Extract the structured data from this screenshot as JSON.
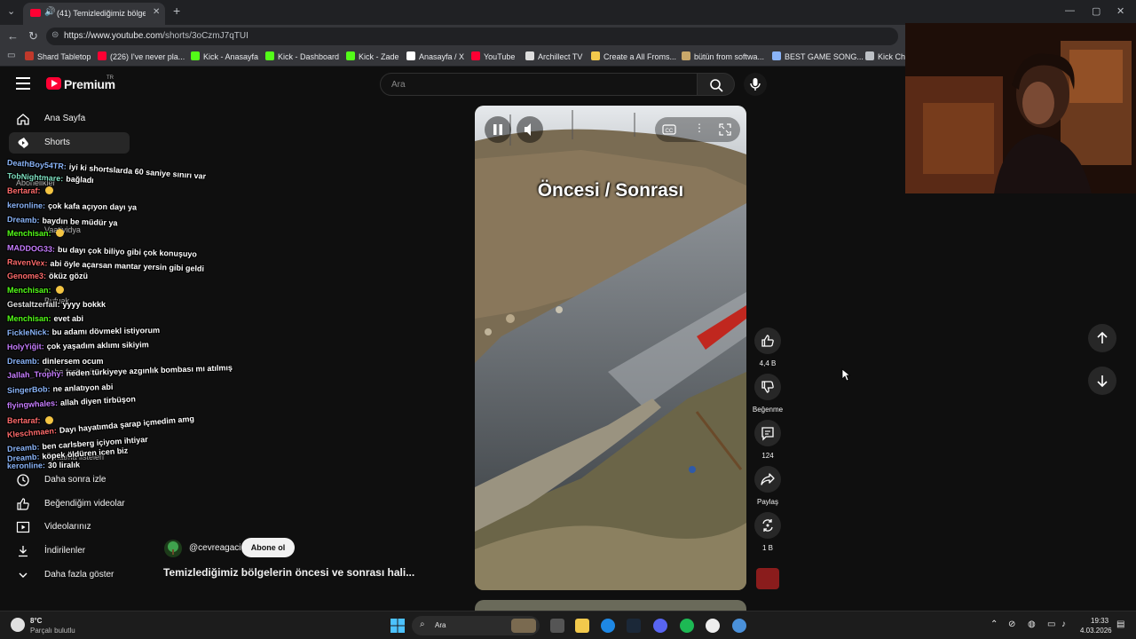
{
  "browser": {
    "tab_title": "(41) Temizlediğimiz bölgelerin",
    "url_host": "https://www.youtube.com",
    "url_path": "/shorts/3oCzmJ7qTUI",
    "bookmarks": [
      "Shard Tabletop",
      "(226) I've never pla...",
      "Kick - Anasayfa",
      "Kick - Dashboard",
      "Kick - Zade",
      "Anasayfa / X",
      "YouTube",
      "Archillect TV",
      "Create a All Froms...",
      "bütün from softwa...",
      "BEST GAME SONG...",
      "Kick Ch"
    ],
    "bookmark_colors": [
      "#c0392b",
      "#ff0033",
      "#53fc18",
      "#53fc18",
      "#53fc18",
      "#ffffff",
      "#ff0033",
      "#dddddd",
      "#f2c94c",
      "#c9a86a",
      "#8ab4f8",
      "#bdc1c6"
    ]
  },
  "youtube": {
    "logo_text": "Premium",
    "region": "TR",
    "search_placeholder": "Ara"
  },
  "sidebar": {
    "items": [
      {
        "label": "Ana Sayfa",
        "icon": "home-icon"
      },
      {
        "label": "Shorts",
        "icon": "shorts-icon"
      },
      {
        "label": "Daha sonra izle",
        "icon": "clock-icon"
      },
      {
        "label": "Beğendiğim videolar",
        "icon": "thumbs-up-icon"
      },
      {
        "label": "Videolarınız",
        "icon": "play-square-icon"
      },
      {
        "label": "İndirilenler",
        "icon": "download-icon"
      },
      {
        "label": "Daha fazla göster",
        "icon": "chevron-down-icon"
      }
    ],
    "faded_labels": [
      "Abonelikler",
      "Vaatividya",
      "Bufuak",
      "Daha fazla göster",
      "Oynatma listeleri"
    ]
  },
  "chat": [
    {
      "user": "DeathBoy54TR:",
      "msg": "iyi ki shortslarda 60 saniye sınırı var",
      "color": "#8ab4f8"
    },
    {
      "user": "TobNightmare:",
      "msg": "bağladı",
      "color": "#7ee0c0"
    },
    {
      "user": "Bertaraf:",
      "msg": "",
      "color": "#ff6b6b"
    },
    {
      "user": "keronline:",
      "msg": "çok kafa açıyon dayı ya",
      "color": "#8ab4f8"
    },
    {
      "user": "Dreamb:",
      "msg": "baydın be müdür ya",
      "color": "#8ab4f8"
    },
    {
      "user": "Menchisan:",
      "msg": "",
      "color": "#53fc18"
    },
    {
      "user": "MADDOG33:",
      "msg": "bu dayı çok biliyo gibi çok konuşuyo",
      "color": "#c77dff"
    },
    {
      "user": "RavenVex:",
      "msg": "abi öyle açarsan mantar yersin gibi geldi",
      "color": "#ff6b6b"
    },
    {
      "user": "Genome3:",
      "msg": "öküz gözü",
      "color": "#ff6b6b"
    },
    {
      "user": "Menchisan:",
      "msg": "",
      "color": "#53fc18"
    },
    {
      "user": "Gestaltzerfall:",
      "msg": "yyyy bokkk",
      "color": "#e0e0e0"
    },
    {
      "user": "Menchisan:",
      "msg": "evet abi",
      "color": "#53fc18"
    },
    {
      "user": "FickleNick:",
      "msg": "bu adamı dövmekl istiyorum",
      "color": "#8ab4f8"
    },
    {
      "user": "HolyYiğit:",
      "msg": "çok yaşadım aklımı sikiyim",
      "color": "#c77dff"
    },
    {
      "user": "Dreamb:",
      "msg": "dinlersem ocum",
      "color": "#8ab4f8"
    },
    {
      "user": "Jallah_Trophy:",
      "msg": "neden türkiyeye azgınlık bombası mı atılmış",
      "color": "#c77dff"
    },
    {
      "user": "SingerBob:",
      "msg": "ne anlatıyon abi",
      "color": "#8ab4f8"
    },
    {
      "user": "flyingwhales:",
      "msg": "allah diyen tirbüşon",
      "color": "#c77dff"
    },
    {
      "user": "Bertaraf:",
      "msg": "",
      "color": "#ff6b6b"
    },
    {
      "user": "Kleschmaen:",
      "msg": "Dayı hayatımda şarap içmedim amg",
      "color": "#ff6b6b"
    },
    {
      "user": "Dreamb:",
      "msg": "ben carlsberg içiyom ihtiyar",
      "color": "#8ab4f8"
    },
    {
      "user": "Dreamb:",
      "msg": "köpek öldüren icen biz",
      "color": "#8ab4f8"
    },
    {
      "user": "keronline:",
      "msg": "30 liralık",
      "color": "#8ab4f8"
    }
  ],
  "short": {
    "overlay_text": "Öncesi / Sonrası",
    "channel": "@cevreagaci",
    "subscribe_label": "Abone ol",
    "title": "Temizlediğimiz bölgelerin öncesi ve sonrası hali...",
    "actions": [
      {
        "name": "like",
        "label": "4,4 B",
        "icon": "thumbs-up-icon"
      },
      {
        "name": "dislike",
        "label": "Beğenme",
        "icon": "thumbs-down-icon"
      },
      {
        "name": "comments",
        "label": "124",
        "icon": "comment-icon"
      },
      {
        "name": "share",
        "label": "Paylaş",
        "icon": "share-icon"
      },
      {
        "name": "remix",
        "label": "1 B",
        "icon": "remix-icon"
      }
    ]
  },
  "taskbar": {
    "weather_temp": "8°C",
    "weather_desc": "Parçalı bulutlu",
    "search_label": "Ara",
    "time": "19:33",
    "date": "4.03.2026"
  }
}
